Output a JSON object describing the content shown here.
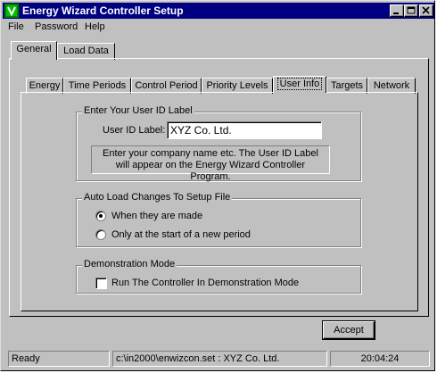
{
  "window": {
    "title": "Energy Wizard Controller Setup"
  },
  "menu": {
    "file": "File",
    "password": "Password",
    "help": "Help"
  },
  "outer_tabs": [
    {
      "label": "General"
    },
    {
      "label": "Load Data"
    }
  ],
  "inner_tabs": [
    {
      "label": "Energy"
    },
    {
      "label": "Time Periods"
    },
    {
      "label": "Control Period"
    },
    {
      "label": "Priority Levels"
    },
    {
      "label": "User Info"
    },
    {
      "label": "Targets"
    },
    {
      "label": "Network"
    }
  ],
  "user_id_group": {
    "title": "Enter Your User ID Label",
    "field_label": "User ID Label:",
    "field_value": "XYZ Co. Ltd.",
    "hint": "Enter your company name etc. The User ID Label will appear on the Energy Wizard Controller Program."
  },
  "auto_load_group": {
    "title": "Auto Load Changes To Setup File",
    "options": [
      {
        "label": "When they are made",
        "selected": true
      },
      {
        "label": "Only at the start of a new period",
        "selected": false
      }
    ]
  },
  "demo_group": {
    "title": "Demonstration Mode",
    "checkbox_label": "Run The Controller In Demonstration Mode",
    "checked": false
  },
  "buttons": {
    "accept": "Accept"
  },
  "status": {
    "state": "Ready",
    "file": "c:\\in2000\\enwizcon.set : XYZ Co. Ltd.",
    "time": "20:04:24"
  }
}
